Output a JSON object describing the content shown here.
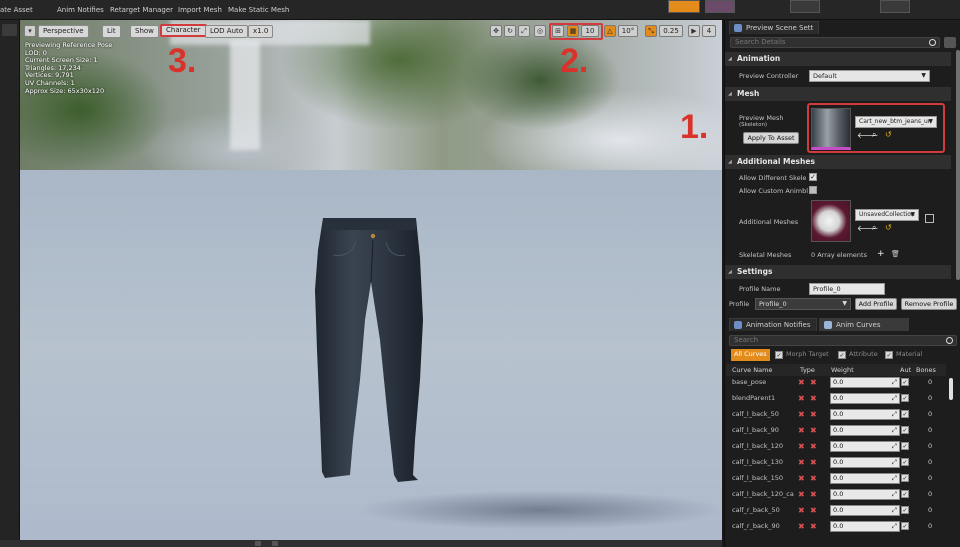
{
  "toolbar": {
    "items": [
      "ate Asset",
      "Anim Notifies",
      "Retarget Manager",
      "Import Mesh",
      "Make Static Mesh"
    ]
  },
  "viewport": {
    "perspective_label": "Perspective",
    "lit_label": "Lit",
    "show_label": "Show",
    "character_label": "Character",
    "lod_label": "LOD Auto",
    "speed_label": "x1.0",
    "grid_value": "10",
    "angle_value": "10°",
    "scale_value": "0.25",
    "camera_value": "4",
    "info_lines": [
      "Previewing Reference Pose",
      "LOD: 0",
      "Current Screen Size: 1",
      "Triangles: 17,234",
      "Vertices: 9,791",
      "UV Channels: 1",
      "Approx Size: 65x30x120"
    ],
    "annotations": [
      "1.",
      "2.",
      "3."
    ]
  },
  "preview_panel": {
    "tab_label": "Preview Scene Sett",
    "search_placeholder": "Search Details",
    "animation_section": "Animation",
    "preview_controller_label": "Preview Controller",
    "preview_controller_value": "Default",
    "mesh_section": "Mesh",
    "preview_mesh_label": "Preview Mesh",
    "preview_mesh_sublabel": "(Skeleton)",
    "apply_button": "Apply To Asset",
    "mesh_value": "Cart_new_btm_jeans_un",
    "additional_section": "Additional Meshes",
    "allow_diff_label": "Allow Different Skele",
    "allow_custom_label": "Allow Custom Animbl",
    "additional_meshes_label": "Additional Meshes",
    "additional_meshes_value": "UnsavedCollection",
    "skeletal_meshes_label": "Skeletal Meshes",
    "array_elements": "0 Array elements",
    "settings_section": "Settings",
    "profile_name_label": "Profile Name",
    "profile_name_value": "Profile_0",
    "profile_label": "Profile",
    "profile_value": "Profile_0",
    "add_profile_button": "Add Profile",
    "remove_profile_button": "Remove Profile"
  },
  "curves_panel": {
    "tab_notifies": "Animation Notifies",
    "tab_curves": "Anim Curves",
    "search_placeholder": "Search",
    "filters": {
      "all": "All Curves",
      "morph": "Morph Target",
      "attribute": "Attribute",
      "material": "Material"
    },
    "columns": [
      "Curve Name",
      "Type",
      "Weight",
      "Aut",
      "Bones"
    ],
    "rows": [
      {
        "name": "base_pose",
        "weight": "0.0",
        "bones": "0"
      },
      {
        "name": "blendParent1",
        "weight": "0.0",
        "bones": "0"
      },
      {
        "name": "calf_l_back_50",
        "weight": "0.0",
        "bones": "0"
      },
      {
        "name": "calf_l_back_90",
        "weight": "0.0",
        "bones": "0"
      },
      {
        "name": "calf_l_back_120",
        "weight": "0.0",
        "bones": "0"
      },
      {
        "name": "calf_l_back_130",
        "weight": "0.0",
        "bones": "0"
      },
      {
        "name": "calf_l_back_150",
        "weight": "0.0",
        "bones": "0"
      },
      {
        "name": "calf_l_back_120_ca",
        "weight": "0.0",
        "bones": "0"
      },
      {
        "name": "calf_r_back_50",
        "weight": "0.0",
        "bones": "0"
      },
      {
        "name": "calf_r_back_90",
        "weight": "0.0",
        "bones": "0"
      }
    ]
  },
  "colors": {
    "accent_orange": "#e38c1c",
    "annotation_red": "#d8332b"
  }
}
